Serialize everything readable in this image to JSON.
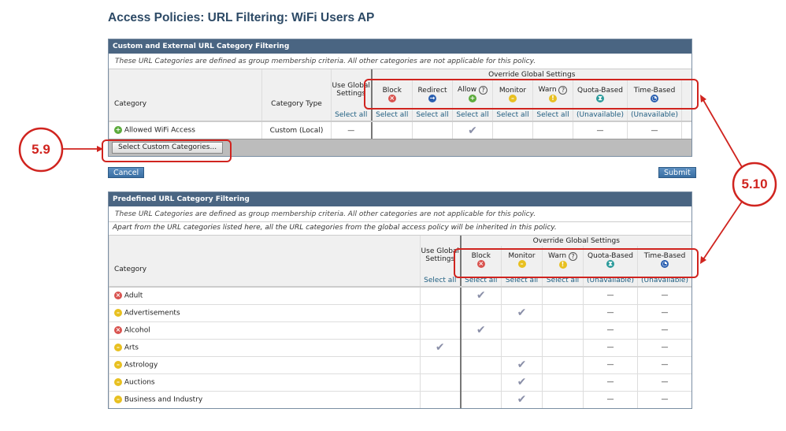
{
  "title": "Access Policies: URL Filtering: WiFi Users AP",
  "custom": {
    "header": "Custom and External URL Category Filtering",
    "note": "These URL Categories are defined as group membership criteria. All other categories are not applicable for this policy.",
    "col_category": "Category",
    "col_type": "Category Type",
    "col_global": "Use Global Settings",
    "override": "Override Global Settings",
    "actions": [
      "Block",
      "Redirect",
      "Allow",
      "Monitor",
      "Warn",
      "Quota-Based",
      "Time-Based"
    ],
    "select_all": "Select all",
    "unavailable": "(Unavailable)",
    "dash": "—",
    "row": {
      "name": "Allowed WiFi Access",
      "type": "Custom (Local)",
      "selected": "Allow"
    },
    "select_custom_button": "Select Custom Categories..."
  },
  "cancel": "Cancel",
  "submit": "Submit",
  "predefined": {
    "header": "Predefined URL Category Filtering",
    "note": "These URL Categories are defined as group membership criteria. All other categories are not applicable for this policy.",
    "note2": "Apart from the URL categories listed here, all the URL categories from the global access policy will be inherited in this policy.",
    "col_category": "Category",
    "col_global": "Use Global Settings",
    "override": "Override Global Settings",
    "actions": [
      "Block",
      "Monitor",
      "Warn",
      "Quota-Based",
      "Time-Based"
    ],
    "rows": [
      {
        "name": "Adult",
        "icon": "block",
        "selected": "Block"
      },
      {
        "name": "Advertisements",
        "icon": "monitor",
        "selected": "Monitor"
      },
      {
        "name": "Alcohol",
        "icon": "block",
        "selected": "Block"
      },
      {
        "name": "Arts",
        "icon": "monitor",
        "selected": "Global"
      },
      {
        "name": "Astrology",
        "icon": "monitor",
        "selected": "Monitor"
      },
      {
        "name": "Auctions",
        "icon": "monitor",
        "selected": "Monitor"
      },
      {
        "name": "Business and Industry",
        "icon": "monitor",
        "selected": "Monitor"
      }
    ]
  },
  "annotations": {
    "a": "5.9",
    "b": "5.10"
  },
  "colors": {
    "accent": "#d0241f",
    "header": "#4a6582"
  }
}
